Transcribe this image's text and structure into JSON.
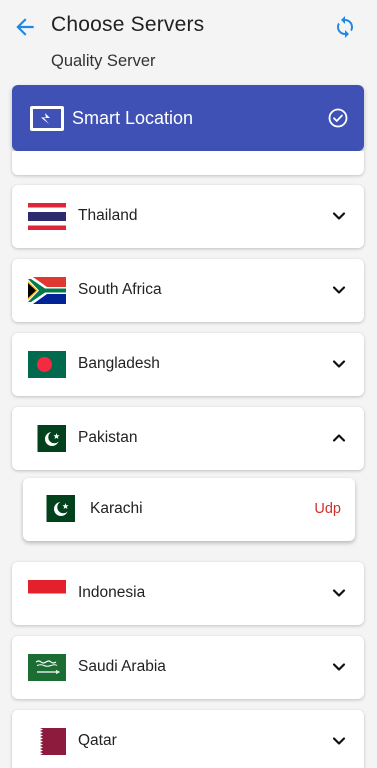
{
  "header": {
    "title": "Choose Servers",
    "subtitle": "Quality Server"
  },
  "smart_location": {
    "label": "Smart Location",
    "selected": true
  },
  "countries": [
    {
      "name": "Thailand",
      "expanded": false
    },
    {
      "name": "South Africa",
      "expanded": false
    },
    {
      "name": "Bangladesh",
      "expanded": false
    },
    {
      "name": "Pakistan",
      "expanded": true
    },
    {
      "name": "Indonesia",
      "expanded": false
    },
    {
      "name": "Saudi Arabia",
      "expanded": false
    },
    {
      "name": "Qatar",
      "expanded": false
    }
  ],
  "servers": [
    {
      "city": "Karachi",
      "protocol": "Udp"
    }
  ],
  "colors": {
    "accent": "#1e88e5",
    "smart_bg": "#3f51b5",
    "protocol": "#d32f2f"
  }
}
